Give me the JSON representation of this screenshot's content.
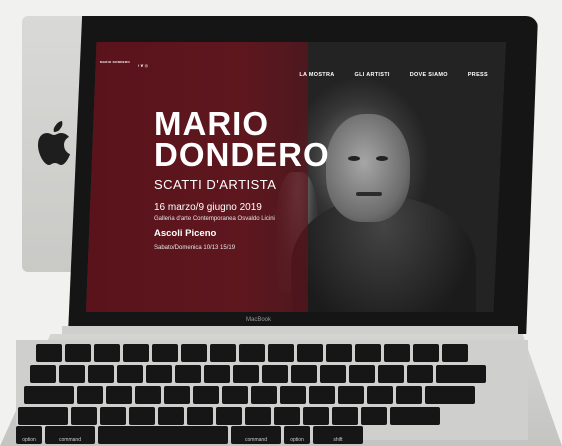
{
  "site": {
    "logo_text": "MARIO DONDERO",
    "social_icons": [
      "facebook-icon",
      "twitter-icon",
      "instagram-icon"
    ],
    "social_glyphs": "f ❦ ◎"
  },
  "nav": {
    "items": [
      {
        "label": "LA MOSTRA"
      },
      {
        "label": "GLI ARTISTI"
      },
      {
        "label": "DOVE SIAMO"
      },
      {
        "label": "PRESS"
      }
    ]
  },
  "hero": {
    "title_line1": "MARIO",
    "title_line2": "DONDERO",
    "subtitle": "SCATTI D'ARTISTA",
    "dates": "16 marzo/9 giugno 2019",
    "venue": "Galleria d'arte Contemporanea Osvaldo Licini",
    "city": "Ascoli Piceno",
    "hours": "Sabato/Domenica 10/13 15/19"
  },
  "device": {
    "brand": "MacBook"
  },
  "keyboard": {
    "bottom_row_labels": [
      "option",
      "command",
      "",
      "command",
      "option",
      "shift"
    ]
  },
  "colors": {
    "panel": "#5d121a",
    "background": "#f1f1ef"
  }
}
